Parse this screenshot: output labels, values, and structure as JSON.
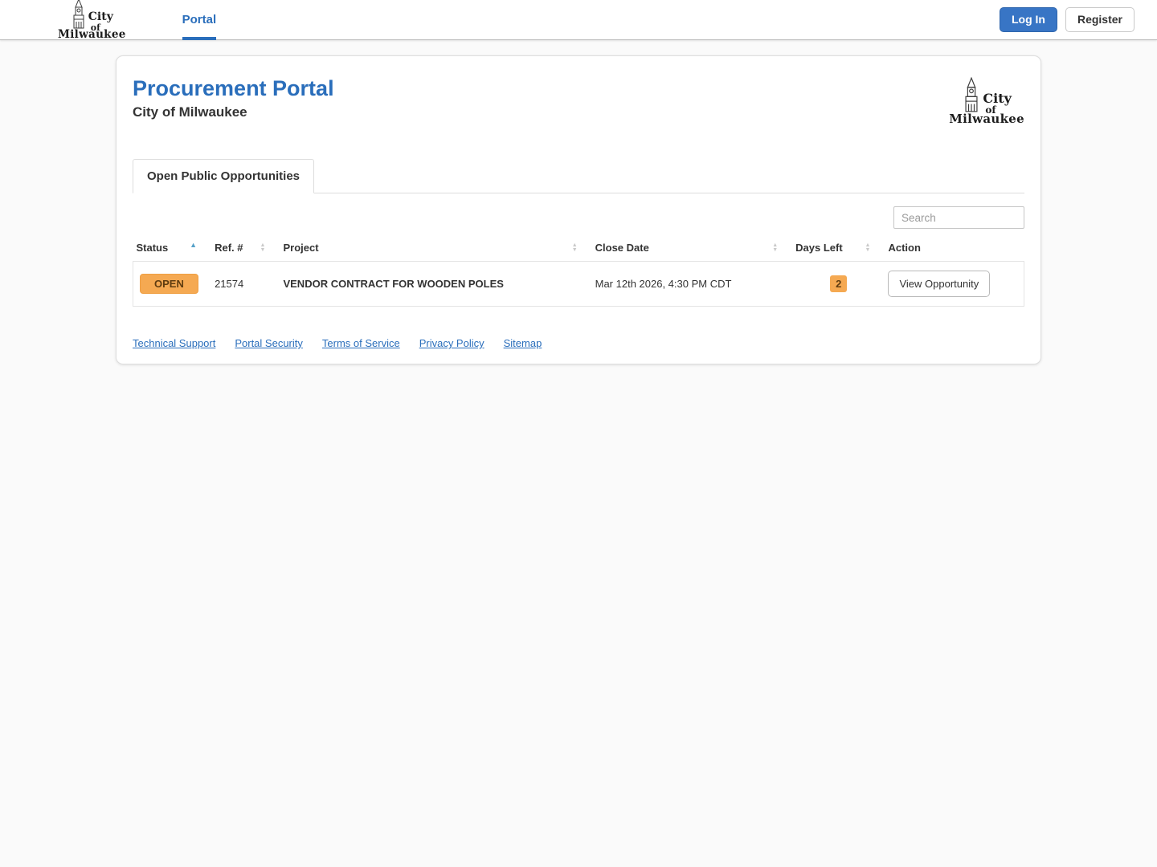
{
  "brand": {
    "city": "City",
    "of": "of",
    "milwaukee": "Milwaukee"
  },
  "navbar": {
    "portal_label": "Portal",
    "login_label": "Log In",
    "register_label": "Register"
  },
  "card": {
    "title": "Procurement Portal",
    "subtitle": "City of Milwaukee"
  },
  "tabs": {
    "open_public": {
      "label": "Open Public Opportunities",
      "active": true
    }
  },
  "search": {
    "placeholder": "Search",
    "value": ""
  },
  "table": {
    "columns": [
      {
        "label": "Status",
        "sort": "asc"
      },
      {
        "label": "Ref. #",
        "sort": "none"
      },
      {
        "label": "Project",
        "sort": "none"
      },
      {
        "label": "Close Date",
        "sort": "none"
      },
      {
        "label": "Days Left",
        "sort": "none"
      },
      {
        "label": "Action",
        "sort": null
      }
    ],
    "rows": [
      {
        "status": "OPEN",
        "ref": "21574",
        "project": "VENDOR CONTRACT FOR WOODEN POLES",
        "close_date": "Mar 12th 2026, 4:30 PM CDT",
        "days_left": "2",
        "action_label": "View Opportunity"
      }
    ]
  },
  "footer": {
    "links": [
      "Technical Support",
      "Portal Security",
      "Terms of Service",
      "Privacy Policy",
      "Sitemap"
    ]
  },
  "icons": {
    "sort_asc": "▲",
    "sort_up": "▲",
    "sort_down": "▼"
  },
  "colors": {
    "accent_blue": "#2a6ebb",
    "login_button_blue": "#3875c5",
    "status_badge_orange": "#f5a952",
    "status_badge_text": "#5f3c10",
    "border_gray": "#e4e4e4"
  }
}
